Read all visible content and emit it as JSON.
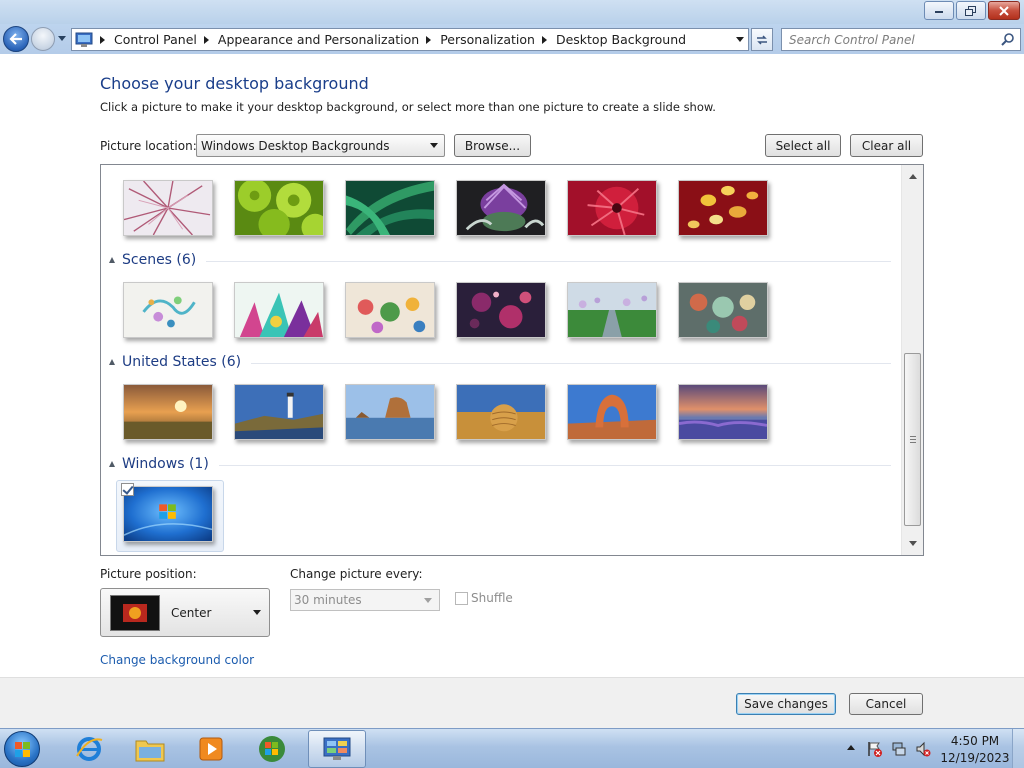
{
  "address_bar": {
    "breadcrumbs": [
      "Control Panel",
      "Appearance and Personalization",
      "Personalization",
      "Desktop Background"
    ]
  },
  "search": {
    "placeholder": "Search Control Panel"
  },
  "page": {
    "heading": "Choose your desktop background",
    "subheading": "Click a picture to make it your desktop background, or select more than one picture to create a slide show."
  },
  "picture_location": {
    "label": "Picture location:",
    "value": "Windows Desktop Backgrounds",
    "browse_label": "Browse...",
    "select_all_label": "Select all",
    "clear_all_label": "Clear all"
  },
  "groups": [
    {
      "title": "Scenes (6)"
    },
    {
      "title": "United States (6)"
    },
    {
      "title": "Windows (1)"
    }
  ],
  "picture_position": {
    "label": "Picture position:",
    "value": "Center"
  },
  "change_picture": {
    "label": "Change picture every:",
    "value": "30 minutes",
    "shuffle_label": "Shuffle"
  },
  "links": {
    "change_color": "Change background color"
  },
  "footer": {
    "save_label": "Save changes",
    "cancel_label": "Cancel"
  },
  "taskbar": {
    "time": "4:50 PM",
    "date": "12/19/2023"
  },
  "colors": {
    "heading": "#1a3e8a",
    "group_title": "#1e3d84",
    "link": "#1c5cae"
  }
}
